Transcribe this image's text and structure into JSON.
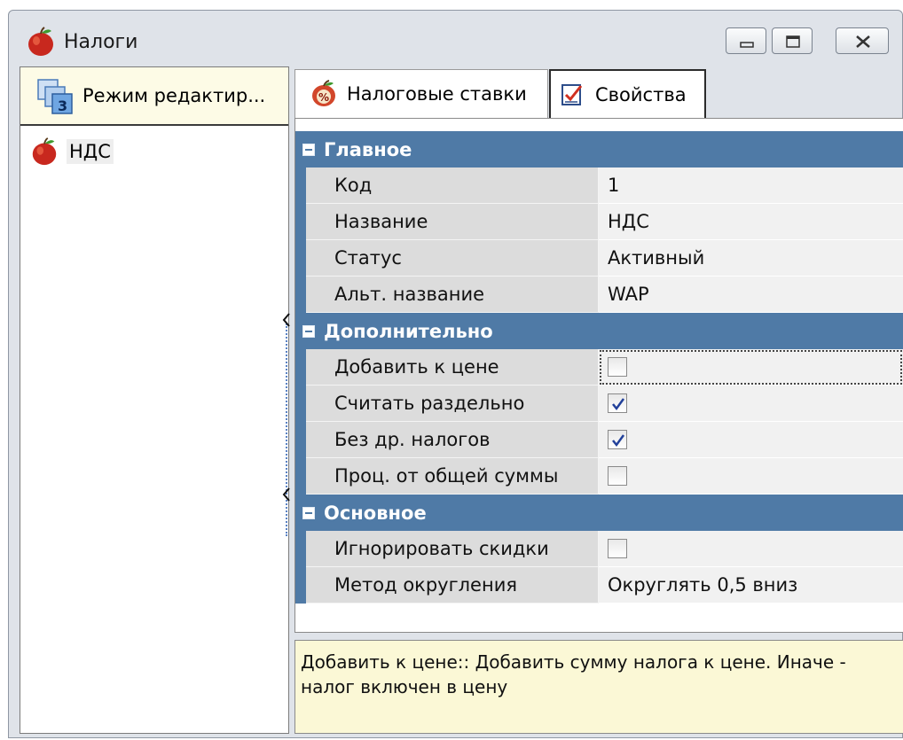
{
  "window": {
    "title": "Налоги",
    "icon": "apple-icon",
    "controls": [
      "minimize-icon",
      "maximize-icon",
      "close-icon"
    ]
  },
  "left_panel": {
    "mode_label": "Режим редактир...",
    "mode_icon": "layers-3-icon",
    "tree_items": [
      {
        "label": "НДС",
        "icon": "apple-icon"
      }
    ]
  },
  "tabs": [
    {
      "label": "Налоговые ставки",
      "icon": "percent-apple-icon",
      "active": false
    },
    {
      "label": "Свойства",
      "icon": "checklist-icon",
      "active": true
    }
  ],
  "property_grid": {
    "categories": [
      {
        "name": "Главное",
        "rows": [
          {
            "name": "Код",
            "value": "1"
          },
          {
            "name": "Название",
            "value": "НДС"
          },
          {
            "name": "Статус",
            "value": "Активный"
          },
          {
            "name": "Альт. название",
            "value": "WAP"
          }
        ]
      },
      {
        "name": "Дополнительно",
        "rows": [
          {
            "name": "Добавить к цене",
            "checked": false
          },
          {
            "name": "Считать раздельно",
            "checked": true
          },
          {
            "name": "Без др. налогов",
            "checked": true
          },
          {
            "name": "Проц. от общей суммы",
            "checked": false
          }
        ]
      },
      {
        "name": "Основное",
        "rows": [
          {
            "name": "Игнорировать скидки",
            "checked": false
          },
          {
            "name": "Метод округления",
            "value": "Округлять 0,5 вниз"
          }
        ]
      }
    ]
  },
  "description": {
    "text": "Добавить к цене:: Добавить сумму налога к цене. Иначе - налог включен в цену"
  },
  "colors": {
    "category_header": "#4f7aa6",
    "description_bg": "#fbf8d6",
    "left_header_bg": "#fdfbe6"
  }
}
